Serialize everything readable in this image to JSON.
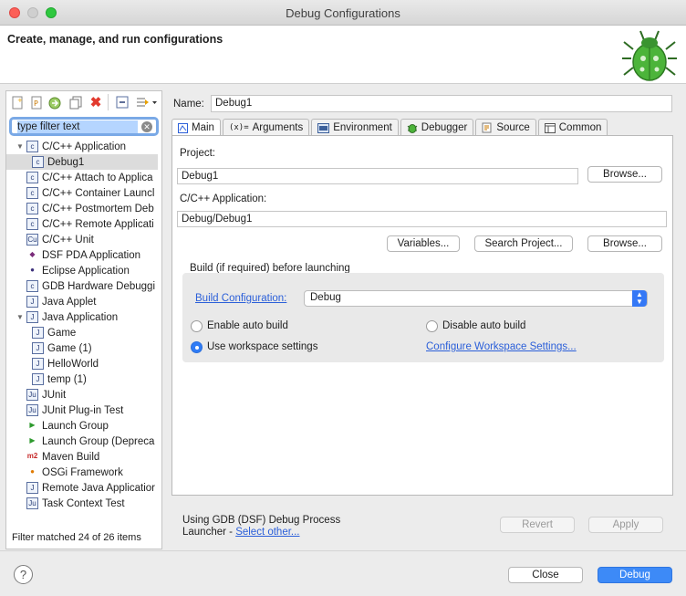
{
  "window": {
    "title": "Debug Configurations"
  },
  "header": {
    "title": "Create, manage, and run configurations"
  },
  "filter": {
    "value": "type filter text"
  },
  "tree": [
    {
      "label": "C/C++ Application",
      "icon": "cpp-app-icon",
      "level": 0,
      "expanded": true
    },
    {
      "label": "Debug1",
      "icon": "cpp-config-icon",
      "level": 1,
      "selected": true
    },
    {
      "label": "C/C++ Attach to Applica",
      "icon": "cpp-attach-icon",
      "level": 0
    },
    {
      "label": "C/C++ Container Launcl",
      "icon": "cpp-container-icon",
      "level": 0
    },
    {
      "label": "C/C++ Postmortem Deb",
      "icon": "cpp-postmortem-icon",
      "level": 0
    },
    {
      "label": "C/C++ Remote Applicati",
      "icon": "cpp-remote-icon",
      "level": 0
    },
    {
      "label": "C/C++ Unit",
      "icon": "cpp-unit-icon",
      "level": 0
    },
    {
      "label": "DSF PDA Application",
      "icon": "dsf-pda-icon",
      "level": 0
    },
    {
      "label": "Eclipse Application",
      "icon": "eclipse-icon",
      "level": 0
    },
    {
      "label": "GDB Hardware Debuggi",
      "icon": "gdb-hardware-icon",
      "level": 0
    },
    {
      "label": "Java Applet",
      "icon": "java-applet-icon",
      "level": 0
    },
    {
      "label": "Java Application",
      "icon": "java-app-icon",
      "level": 0,
      "expanded": true
    },
    {
      "label": "Game",
      "icon": "java-config-icon",
      "level": 1
    },
    {
      "label": "Game (1)",
      "icon": "java-config-icon",
      "level": 1
    },
    {
      "label": "HelloWorld",
      "icon": "java-config-icon",
      "level": 1
    },
    {
      "label": "temp (1)",
      "icon": "java-config-icon",
      "level": 1
    },
    {
      "label": "JUnit",
      "icon": "junit-icon",
      "level": 0
    },
    {
      "label": "JUnit Plug-in Test",
      "icon": "junit-plugin-icon",
      "level": 0
    },
    {
      "label": "Launch Group",
      "icon": "launch-group-icon",
      "level": 0
    },
    {
      "label": "Launch Group (Depreca",
      "icon": "launch-group-deprecated-icon",
      "level": 0
    },
    {
      "label": "Maven Build",
      "icon": "maven-icon",
      "level": 0
    },
    {
      "label": "OSGi Framework",
      "icon": "osgi-icon",
      "level": 0
    },
    {
      "label": "Remote Java Applicatior",
      "icon": "remote-java-icon",
      "level": 0
    },
    {
      "label": "Task Context Test",
      "icon": "task-context-icon",
      "level": 0
    }
  ],
  "filter_status": "Filter matched 24 of 26 items",
  "name": {
    "label": "Name:",
    "value": "Debug1"
  },
  "tabs": [
    "Main",
    "Arguments",
    "Environment",
    "Debugger",
    "Source",
    "Common"
  ],
  "main": {
    "project_label": "Project:",
    "project_value": "Debug1",
    "browse": "Browse...",
    "app_label": "C/C++ Application:",
    "app_value": "Debug/Debug1",
    "variables": "Variables...",
    "search_project": "Search Project...",
    "browse2": "Browse...",
    "build_group_title": "Build (if required) before launching",
    "build_config_label": "Build Configuration:",
    "build_config_value": "Debug",
    "enable_auto": "Enable auto build",
    "disable_auto": "Disable auto build",
    "use_workspace": "Use workspace settings",
    "configure_workspace": "Configure Workspace Settings..."
  },
  "launcher": {
    "line1": "Using GDB (DSF) Debug Process",
    "line2_prefix": "Launcher - ",
    "link": "Select other..."
  },
  "buttons": {
    "revert": "Revert",
    "apply": "Apply",
    "close": "Close",
    "debug": "Debug"
  },
  "colors": {
    "accent": "#3d8af7",
    "link": "#2b5fd9",
    "bug": "#3ea832"
  }
}
